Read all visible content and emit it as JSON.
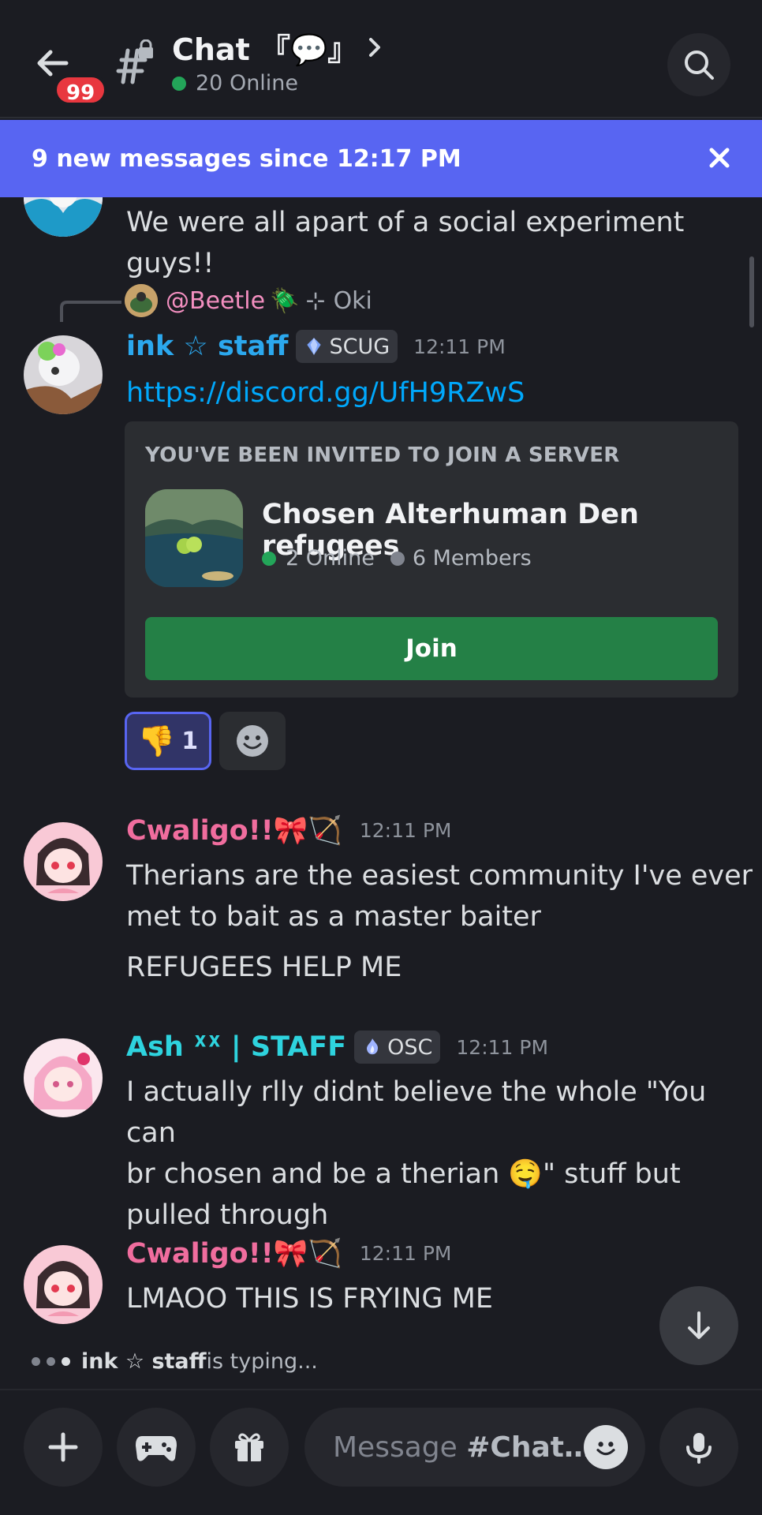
{
  "header": {
    "unread_badge": "99",
    "title": "Chat 『💬』",
    "online": "20 Online"
  },
  "banner": {
    "text": "9 new messages since 12:17 PM"
  },
  "messages": [
    {
      "text": "We were all apart of a social experiment guys!!"
    },
    {
      "reply_to": "@Beetle",
      "reply_emoji": "🪲",
      "reply_sep": "⊹",
      "reply_text": "Oki",
      "username": "ink ☆ staff",
      "username_color": "#2ba8ee",
      "tag": "SCUG",
      "time": "12:11 PM",
      "link": "https://discord.gg/UfH9RZwS",
      "invite": {
        "heading": "YOU'VE BEEN INVITED TO JOIN A SERVER",
        "server_name": "Chosen Alterhuman Den refugees",
        "online": "2 Online",
        "members": "6 Members",
        "join_label": "Join"
      },
      "reaction": {
        "emoji": "👎",
        "count": "1"
      }
    },
    {
      "username": "Cwaligo!!🎀🏹",
      "username_color": "#f06d9e",
      "time": "12:11 PM",
      "lines": [
        "Therians are the easiest community I've ever",
        "met to bait as a master baiter"
      ],
      "text2": "REFUGEES HELP ME"
    },
    {
      "username": "Ash ᕽᕽ | STAFF",
      "username_color": "#2ed3de",
      "tag": "OSC",
      "time": "12:11 PM",
      "lines": [
        "I actually rlly didnt believe the whole \"You can",
        "br chosen and be a therian 🤤\" stuff but",
        "pulled through"
      ]
    },
    {
      "username": "Cwaligo!!🎀🏹",
      "username_color": "#f06d9e",
      "time": "12:11 PM",
      "text": "LMAOO THIS IS FRYING ME"
    }
  ],
  "typing": {
    "user": "ink ☆ staff",
    "suffix": " is typing..."
  },
  "composer": {
    "placeholder_prefix": "Message ",
    "placeholder_channel": "#Chat…"
  },
  "colors": {
    "background": "#1b1c22",
    "banner": "#5865f2",
    "join": "#248046",
    "online": "#23a559"
  }
}
